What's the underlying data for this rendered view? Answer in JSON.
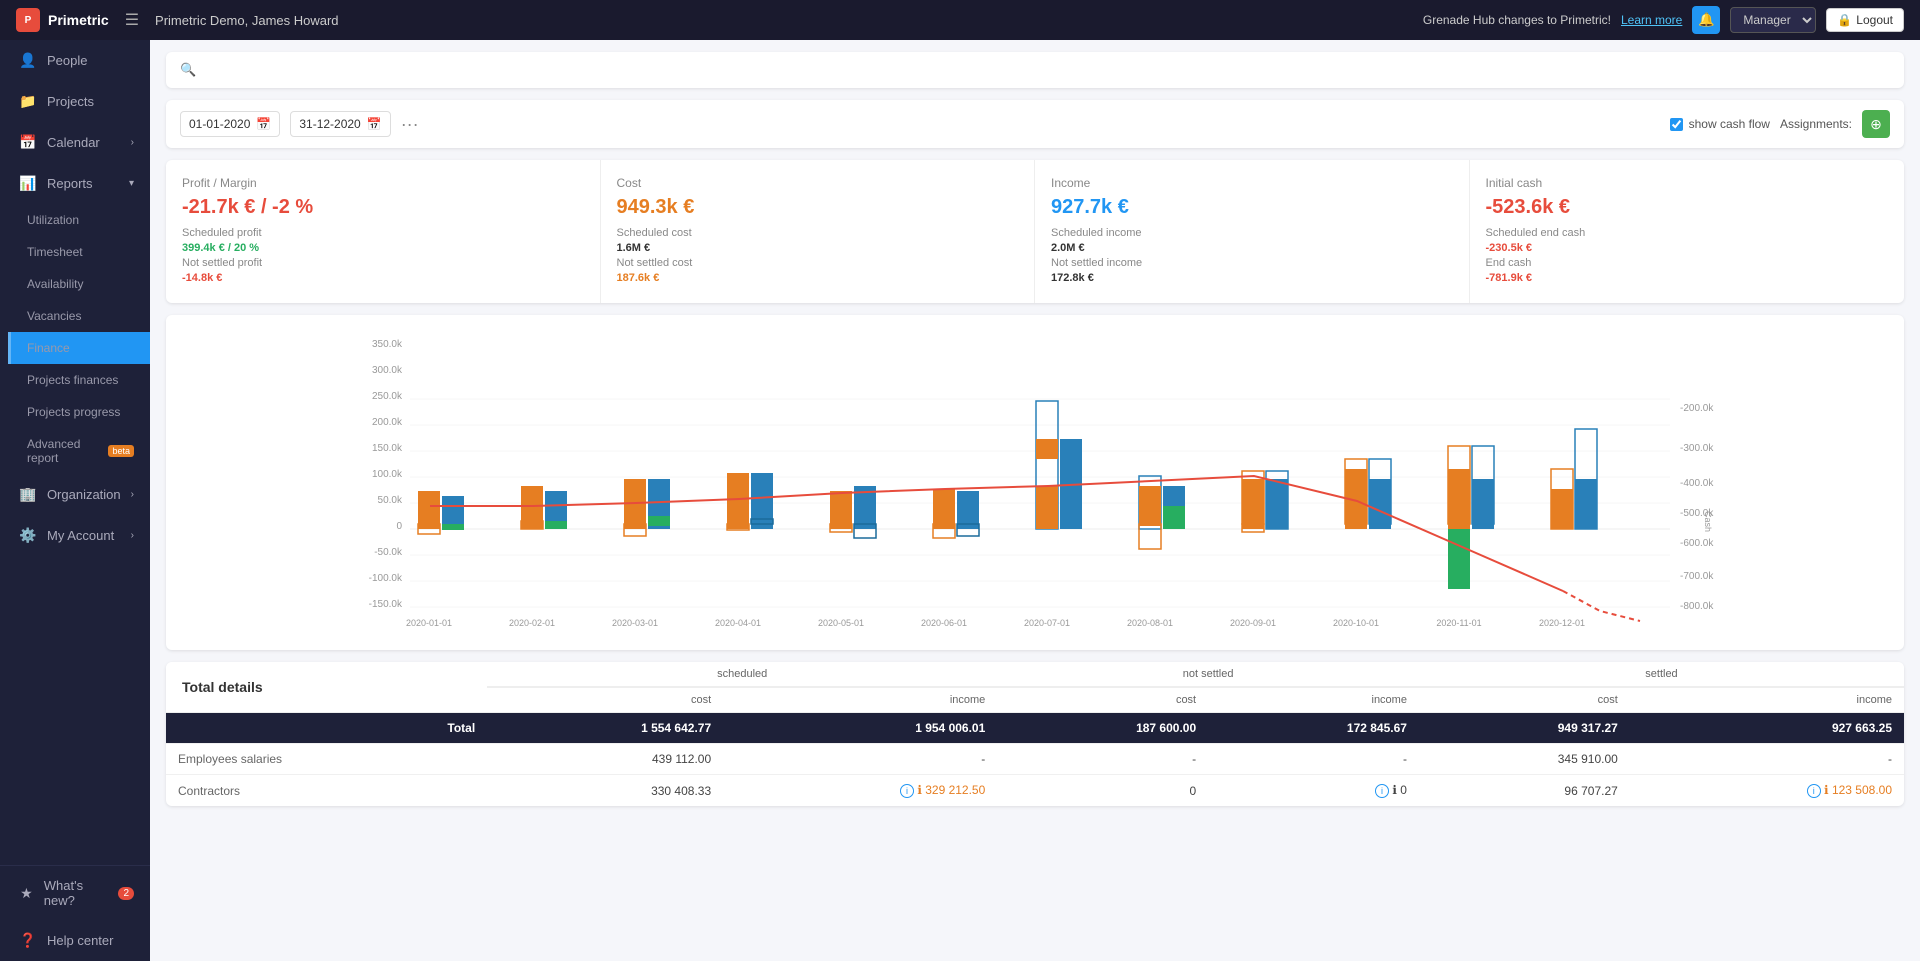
{
  "topbar": {
    "app_name": "Primetric",
    "breadcrumb": "Primetric Demo, James Howard",
    "notification_text": "Grenade Hub changes to Primetric!",
    "learn_more": "Learn more",
    "manager_label": "Manager",
    "logout_label": "Logout"
  },
  "sidebar": {
    "items": [
      {
        "id": "people",
        "label": "People",
        "icon": "👤"
      },
      {
        "id": "projects",
        "label": "Projects",
        "icon": "📁"
      },
      {
        "id": "calendar",
        "label": "Calendar",
        "icon": "📅",
        "has_arrow": true
      },
      {
        "id": "reports",
        "label": "Reports",
        "icon": "📊",
        "has_arrow": true
      },
      {
        "id": "utilization",
        "label": "Utilization",
        "icon": ""
      },
      {
        "id": "timesheet",
        "label": "Timesheet",
        "icon": ""
      },
      {
        "id": "availability",
        "label": "Availability",
        "icon": ""
      },
      {
        "id": "vacancies",
        "label": "Vacancies",
        "icon": ""
      },
      {
        "id": "finance",
        "label": "Finance",
        "icon": "",
        "active": true
      },
      {
        "id": "projects-finances",
        "label": "Projects finances",
        "icon": ""
      },
      {
        "id": "projects-progress",
        "label": "Projects progress",
        "icon": ""
      },
      {
        "id": "advanced-report",
        "label": "Advanced report",
        "badge": "beta",
        "icon": ""
      },
      {
        "id": "organization",
        "label": "Organization",
        "icon": "🏢",
        "has_arrow": true
      },
      {
        "id": "my-account",
        "label": "My Account",
        "icon": "⚙️",
        "has_arrow": true
      }
    ],
    "bottom": {
      "whats_new": "What's new?",
      "whats_new_count": "2",
      "help_center": "Help center"
    }
  },
  "filters": {
    "date_from": "01-01-2020",
    "date_to": "31-12-2020",
    "show_cash_flow_label": "show cash flow",
    "assignments_label": "Assignments:"
  },
  "summary": {
    "profit": {
      "title": "Profit / Margin",
      "main_value": "-21.7k € / -2 %",
      "scheduled_profit_label": "Scheduled profit",
      "scheduled_profit_value": "399.4k € / 20 %",
      "not_settled_label": "Not settled profit",
      "not_settled_value": "-14.8k €"
    },
    "cost": {
      "title": "Cost",
      "main_value": "949.3k €",
      "scheduled_cost_label": "Scheduled cost",
      "scheduled_cost_value": "1.6M €",
      "not_settled_label": "Not settled cost",
      "not_settled_value": "187.6k €"
    },
    "income": {
      "title": "Income",
      "main_value": "927.7k €",
      "scheduled_income_label": "Scheduled income",
      "scheduled_income_value": "2.0M €",
      "not_settled_label": "Not settled income",
      "not_settled_value": "172.8k €"
    },
    "initial_cash": {
      "title": "Initial cash",
      "main_value": "-523.6k €",
      "scheduled_end_cash_label": "Scheduled end cash",
      "scheduled_end_cash_value": "-230.5k €",
      "end_cash_label": "End cash",
      "end_cash_value": "-781.9k €"
    }
  },
  "chart": {
    "y_axis_labels": [
      "350.0k",
      "300.0k",
      "250.0k",
      "200.0k",
      "150.0k",
      "100.0k",
      "50.0k",
      "0",
      "-50.0k",
      "-100.0k",
      "-150.0k"
    ],
    "y_axis_right": [
      "-200.0k",
      "-300.0k",
      "-400.0k",
      "-500.0k",
      "-600.0k",
      "-700.0k",
      "-800.0k"
    ],
    "x_labels": [
      "2020-01-01",
      "2020-02-01",
      "2020-03-01",
      "2020-04-01",
      "2020-05-01",
      "2020-06-01",
      "2020-07-01",
      "2020-08-01",
      "2020-09-01",
      "2020-10-01",
      "2020-11-01",
      "2020-12-01"
    ],
    "right_axis_label": "Cash"
  },
  "table": {
    "title": "Total details",
    "groups": [
      "scheduled",
      "not settled",
      "settled"
    ],
    "sub_headers": [
      "cost",
      "income",
      "cost",
      "income",
      "cost",
      "income"
    ],
    "total_row": {
      "label": "Total",
      "scheduled_cost": "1 554 642.77",
      "scheduled_income": "1 954 006.01",
      "not_settled_cost": "187 600.00",
      "not_settled_income": "172 845.67",
      "settled_cost": "949 317.27",
      "settled_income": "927 663.25"
    },
    "rows": [
      {
        "label": "Employees salaries",
        "scheduled_cost": "439 112.00",
        "scheduled_income": "-",
        "not_settled_cost": "-",
        "not_settled_income": "-",
        "settled_cost": "345 910.00",
        "settled_income": "-"
      },
      {
        "label": "Contractors",
        "scheduled_cost": "330 408.33",
        "scheduled_income": "ℹ 329 212.50",
        "not_settled_cost": "0",
        "not_settled_income": "ℹ 0",
        "settled_cost": "96 707.27",
        "settled_income": "ℹ 123 508.00"
      }
    ]
  }
}
